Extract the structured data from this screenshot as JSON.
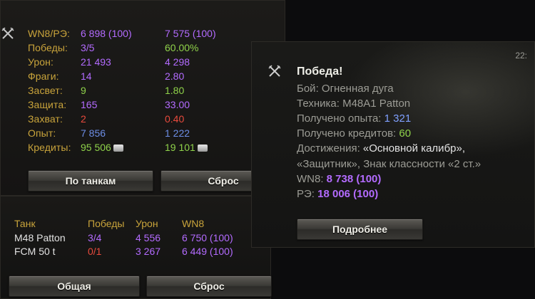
{
  "stats": {
    "rows": [
      {
        "label": "WN8/РЭ:",
        "v1": "6 898 (100)",
        "c1": "purple",
        "v2": "7 575 (100)",
        "c2": "purple"
      },
      {
        "label": "Победы:",
        "v1": "3/5",
        "c1": "purple",
        "v2": "60.00%",
        "c2": "green"
      },
      {
        "label": "Урон:",
        "v1": "21 493",
        "c1": "purple",
        "v2": "4 298",
        "c2": "purple"
      },
      {
        "label": "Фраги:",
        "v1": "14",
        "c1": "purple",
        "v2": "2.80",
        "c2": "purple"
      },
      {
        "label": "Засвет:",
        "v1": "9",
        "c1": "green",
        "v2": "1.80",
        "c2": "green"
      },
      {
        "label": "Защита:",
        "v1": "165",
        "c1": "purple",
        "v2": "33.00",
        "c2": "purple"
      },
      {
        "label": "Захват:",
        "v1": "2",
        "c1": "red",
        "v2": "0.40",
        "c2": "red"
      },
      {
        "label": "Опыт:",
        "v1": "7 856",
        "c1": "blue",
        "v2": "1 222",
        "c2": "blue"
      },
      {
        "label": "Кредиты:",
        "v1": "95 506",
        "c1": "green",
        "v2": "19 101",
        "c2": "green"
      }
    ],
    "by_tanks_button": "По танкам",
    "reset_button": "Сброс"
  },
  "tanks": {
    "headers": [
      "Танк",
      "Победы",
      "Урон",
      "WN8"
    ],
    "rows": [
      {
        "tank": "M48 Patton",
        "wins": "3/4",
        "wins_color": "purple",
        "damage": "4 556",
        "wn8": "6 750 (100)"
      },
      {
        "tank": "FCM 50 t",
        "wins": "0/1",
        "wins_color": "red",
        "damage": "3 267",
        "wn8": "6 449 (100)"
      }
    ],
    "general_button": "Общая",
    "reset_button": "Сброс"
  },
  "popup": {
    "time": "22:",
    "title": "Победа!",
    "battle_label": "Бой:",
    "battle_value": "Огненная дуга",
    "vehicle_label": "Техника:",
    "vehicle_value": "M48A1 Patton",
    "xp_label": "Получено опыта:",
    "xp_value": "1 321",
    "credits_label": "Получено кредитов:",
    "credits_value": "60",
    "achievements_label": "Достижения:",
    "achievements_line1": "«Основной калибр»,",
    "achievements_line2": "«Защитник», Знак классности «2 ст.»",
    "wn8_label": "WN8:",
    "wn8_value": "8 738 (100)",
    "re_label": "РЭ:",
    "re_value": "18 006 (100)",
    "details_button": "Подробнее"
  },
  "colors": {
    "purple": "#b36bff",
    "green": "#8fd24a",
    "blue": "#6d8ee6",
    "red": "#e84a3d",
    "gold": "#c9a43b"
  }
}
